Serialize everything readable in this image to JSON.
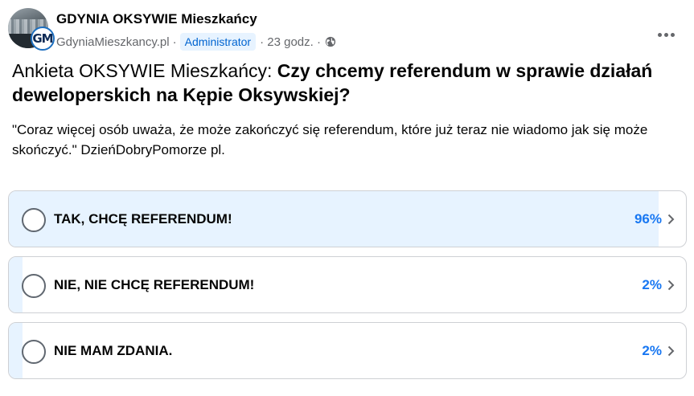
{
  "post": {
    "page_name": "GDYNIA OKSYWIE Mieszkańcy",
    "site": "GdyniaMieszkancy.pl",
    "separator": "·",
    "role_badge": "Administrator",
    "time": "· 23 godz. ·",
    "avatar_badge": "GM",
    "privacy_icon": "globe-icon",
    "more_icon": "more-options-icon"
  },
  "poll": {
    "title_prefix": "Ankieta OKSYWIE Mieszkańcy: ",
    "question": "Czy chcemy referendum w sprawie działań deweloperskich na Kępie Oksywskiej?",
    "description": "\"Coraz więcej osób uważa, że może zakończyć się referendum, które już teraz nie wiadomo jak się może skończyć.\" DzieńDobryPomorze pl.",
    "options": [
      {
        "label": "TAK, CHCĘ REFERENDUM!",
        "percent": "96%",
        "share": 0.96
      },
      {
        "label": "NIE, NIE CHCĘ REFERENDUM!",
        "percent": "2%",
        "share": 0.02
      },
      {
        "label": "NIE MAM ZDANIA.",
        "percent": "2%",
        "share": 0.02
      }
    ]
  },
  "colors": {
    "accent": "#1877f2",
    "fill": "#e7f3ff",
    "badge_text": "#0064d1",
    "meta": "#65676b"
  }
}
